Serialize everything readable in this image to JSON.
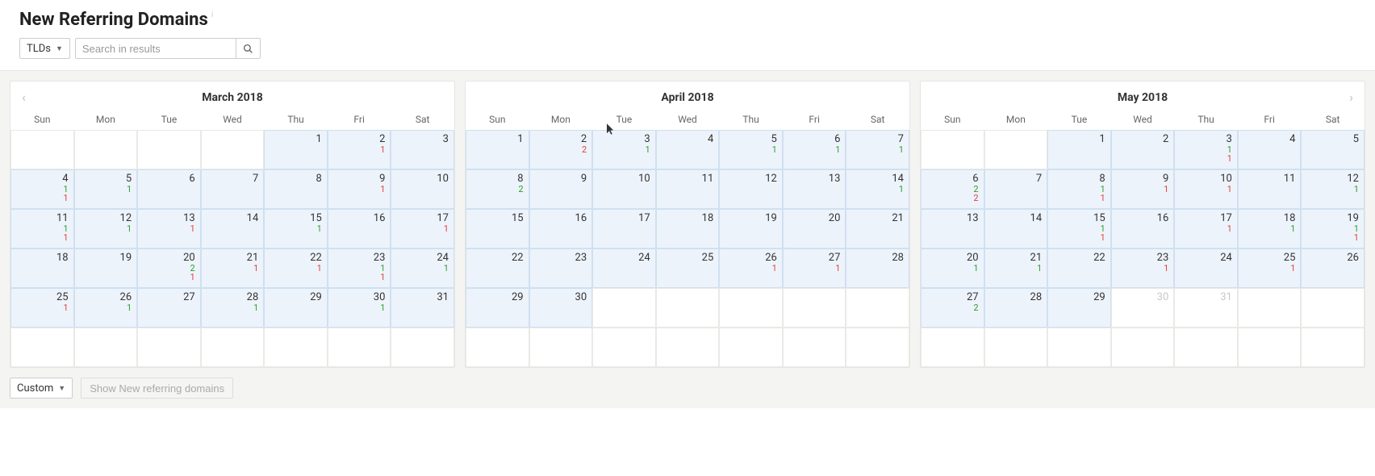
{
  "header": {
    "title": "New Referring Domains"
  },
  "controls": {
    "tldsDropdown": "TLDs",
    "searchPlaceholder": "Search in results"
  },
  "weekdays": [
    "Sun",
    "Mon",
    "Tue",
    "Wed",
    "Thu",
    "Fri",
    "Sat"
  ],
  "months": [
    {
      "title": "March 2018",
      "navPrev": true,
      "navNext": false,
      "start": 4,
      "days": [
        {
          "n": 1,
          "filled": true
        },
        {
          "n": 2,
          "filled": true,
          "r": 1
        },
        {
          "n": 3,
          "filled": true
        },
        {
          "n": 4,
          "filled": true,
          "g": 1,
          "r": 1
        },
        {
          "n": 5,
          "filled": true,
          "g": 1
        },
        {
          "n": 6,
          "filled": true
        },
        {
          "n": 7,
          "filled": true
        },
        {
          "n": 8,
          "filled": true
        },
        {
          "n": 9,
          "filled": true,
          "r": 1
        },
        {
          "n": 10,
          "filled": true
        },
        {
          "n": 11,
          "filled": true,
          "g": 1,
          "r": 1
        },
        {
          "n": 12,
          "filled": true,
          "g": 1
        },
        {
          "n": 13,
          "filled": true,
          "r": 1
        },
        {
          "n": 14,
          "filled": true
        },
        {
          "n": 15,
          "filled": true,
          "g": 1
        },
        {
          "n": 16,
          "filled": true
        },
        {
          "n": 17,
          "filled": true,
          "r": 1
        },
        {
          "n": 18,
          "filled": true
        },
        {
          "n": 19,
          "filled": true
        },
        {
          "n": 20,
          "filled": true,
          "g": 2,
          "r": 1
        },
        {
          "n": 21,
          "filled": true,
          "r": 1
        },
        {
          "n": 22,
          "filled": true,
          "r": 1
        },
        {
          "n": 23,
          "filled": true,
          "g": 1,
          "r": 1
        },
        {
          "n": 24,
          "filled": true,
          "g": 1
        },
        {
          "n": 25,
          "filled": true,
          "r": 1
        },
        {
          "n": 26,
          "filled": true,
          "g": 1
        },
        {
          "n": 27,
          "filled": true
        },
        {
          "n": 28,
          "filled": true,
          "g": 1
        },
        {
          "n": 29,
          "filled": true
        },
        {
          "n": 30,
          "filled": true,
          "g": 1
        },
        {
          "n": 31,
          "filled": true
        }
      ]
    },
    {
      "title": "April 2018",
      "navPrev": false,
      "navNext": false,
      "start": 0,
      "days": [
        {
          "n": 1,
          "filled": true
        },
        {
          "n": 2,
          "filled": true,
          "r": 2
        },
        {
          "n": 3,
          "filled": true,
          "g": 1
        },
        {
          "n": 4,
          "filled": true
        },
        {
          "n": 5,
          "filled": true,
          "g": 1
        },
        {
          "n": 6,
          "filled": true,
          "g": 1
        },
        {
          "n": 7,
          "filled": true,
          "g": 1
        },
        {
          "n": 8,
          "filled": true,
          "g": 2
        },
        {
          "n": 9,
          "filled": true
        },
        {
          "n": 10,
          "filled": true
        },
        {
          "n": 11,
          "filled": true
        },
        {
          "n": 12,
          "filled": true
        },
        {
          "n": 13,
          "filled": true
        },
        {
          "n": 14,
          "filled": true,
          "g": 1
        },
        {
          "n": 15,
          "filled": true
        },
        {
          "n": 16,
          "filled": true
        },
        {
          "n": 17,
          "filled": true
        },
        {
          "n": 18,
          "filled": true
        },
        {
          "n": 19,
          "filled": true
        },
        {
          "n": 20,
          "filled": true
        },
        {
          "n": 21,
          "filled": true
        },
        {
          "n": 22,
          "filled": true
        },
        {
          "n": 23,
          "filled": true
        },
        {
          "n": 24,
          "filled": true
        },
        {
          "n": 25,
          "filled": true
        },
        {
          "n": 26,
          "filled": true,
          "r": 1
        },
        {
          "n": 27,
          "filled": true,
          "r": 1
        },
        {
          "n": 28,
          "filled": true
        },
        {
          "n": 29,
          "filled": true
        },
        {
          "n": 30,
          "filled": true
        }
      ]
    },
    {
      "title": "May 2018",
      "navPrev": false,
      "navNext": true,
      "start": 2,
      "days": [
        {
          "n": 1,
          "filled": true
        },
        {
          "n": 2,
          "filled": true
        },
        {
          "n": 3,
          "filled": true,
          "g": 1,
          "r": 1
        },
        {
          "n": 4,
          "filled": true
        },
        {
          "n": 5,
          "filled": true
        },
        {
          "n": 6,
          "filled": true,
          "g": 2,
          "r": 2
        },
        {
          "n": 7,
          "filled": true
        },
        {
          "n": 8,
          "filled": true,
          "g": 1,
          "r": 1
        },
        {
          "n": 9,
          "filled": true,
          "r": 1
        },
        {
          "n": 10,
          "filled": true,
          "r": 1
        },
        {
          "n": 11,
          "filled": true
        },
        {
          "n": 12,
          "filled": true,
          "g": 1
        },
        {
          "n": 13,
          "filled": true
        },
        {
          "n": 14,
          "filled": true
        },
        {
          "n": 15,
          "filled": true,
          "g": 1,
          "r": 1
        },
        {
          "n": 16,
          "filled": true
        },
        {
          "n": 17,
          "filled": true,
          "r": 1
        },
        {
          "n": 18,
          "filled": true,
          "g": 1
        },
        {
          "n": 19,
          "filled": true,
          "g": 1,
          "r": 1
        },
        {
          "n": 20,
          "filled": true,
          "g": 1
        },
        {
          "n": 21,
          "filled": true,
          "g": 1
        },
        {
          "n": 22,
          "filled": true
        },
        {
          "n": 23,
          "filled": true,
          "r": 1
        },
        {
          "n": 24,
          "filled": true
        },
        {
          "n": 25,
          "filled": true,
          "r": 1
        },
        {
          "n": 26,
          "filled": true
        },
        {
          "n": 27,
          "filled": true,
          "g": 2
        },
        {
          "n": 28,
          "filled": true
        },
        {
          "n": 29,
          "filled": true
        },
        {
          "n": 30,
          "filled": false,
          "dim": true
        },
        {
          "n": 31,
          "filled": false,
          "dim": true
        }
      ]
    }
  ],
  "footer": {
    "customDropdown": "Custom",
    "showButton": "Show New referring domains"
  },
  "cursor": {
    "show": true
  }
}
